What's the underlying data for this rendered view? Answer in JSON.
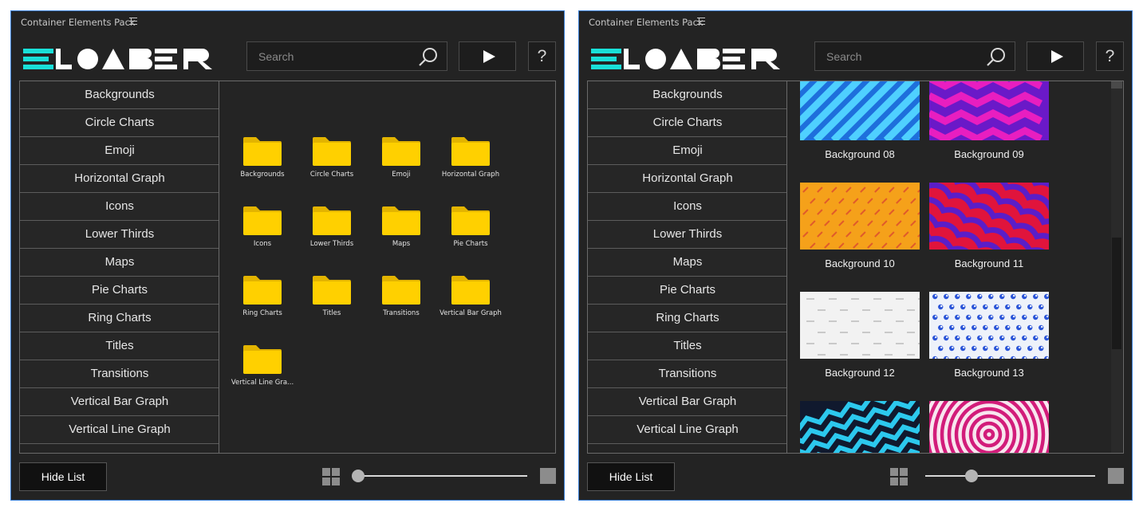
{
  "panels": [
    {
      "title": "Container Elements Pack",
      "search": {
        "placeholder": "Search"
      },
      "help_label": "?",
      "categories": [
        "Backgrounds",
        "Circle Charts",
        "Emoji",
        "Horizontal Graph",
        "Icons",
        "Lower Thirds",
        "Maps",
        "Pie Charts",
        "Ring Charts",
        "Titles",
        "Transitions",
        "Vertical Bar Graph",
        "Vertical Line Graph"
      ],
      "folders": [
        "Backgrounds",
        "Circle Charts",
        "Emoji",
        "Horizontal Graph",
        "Icons",
        "Lower Thirds",
        "Maps",
        "Pie Charts",
        "Ring Charts",
        "Titles",
        "Transitions",
        "Vertical Bar Graph",
        "Vertical Line Gra..."
      ],
      "hide_list_label": "Hide List",
      "zoom_level": 0
    },
    {
      "title": "Container Elements Pack",
      "search": {
        "placeholder": "Search"
      },
      "help_label": "?",
      "categories": [
        "Backgrounds",
        "Circle Charts",
        "Emoji",
        "Horizontal Graph",
        "Icons",
        "Lower Thirds",
        "Maps",
        "Pie Charts",
        "Ring Charts",
        "Titles",
        "Transitions",
        "Vertical Bar Graph",
        "Vertical Line Graph"
      ],
      "thumbnails": [
        {
          "label": "Background 08",
          "pattern": "blue-diagonal-stripes"
        },
        {
          "label": "Background 09",
          "pattern": "magenta-zigzag"
        },
        {
          "label": "Background 10",
          "pattern": "orange-dashes"
        },
        {
          "label": "Background 11",
          "pattern": "red-purple-waves"
        },
        {
          "label": "Background 12",
          "pattern": "light-gray-text-pattern"
        },
        {
          "label": "Background 13",
          "pattern": "blue-dots"
        },
        {
          "label": "",
          "pattern": "cyan-zigzag"
        },
        {
          "label": "",
          "pattern": "pink-concentric-circles"
        }
      ],
      "hide_list_label": "Hide List",
      "zoom_level": 0.28
    }
  ],
  "colors": {
    "accent_logo": "#19e0d8",
    "folder_yellow": "#ffd000",
    "panel_bg": "#232323",
    "panel_border": "#3a7fd6"
  },
  "icons": {
    "search": "search-icon",
    "play": "play-icon",
    "grid_view": "grid-view-icon",
    "large_view": "large-view-icon",
    "menu": "panel-menu-icon",
    "folder": "folder-icon"
  }
}
